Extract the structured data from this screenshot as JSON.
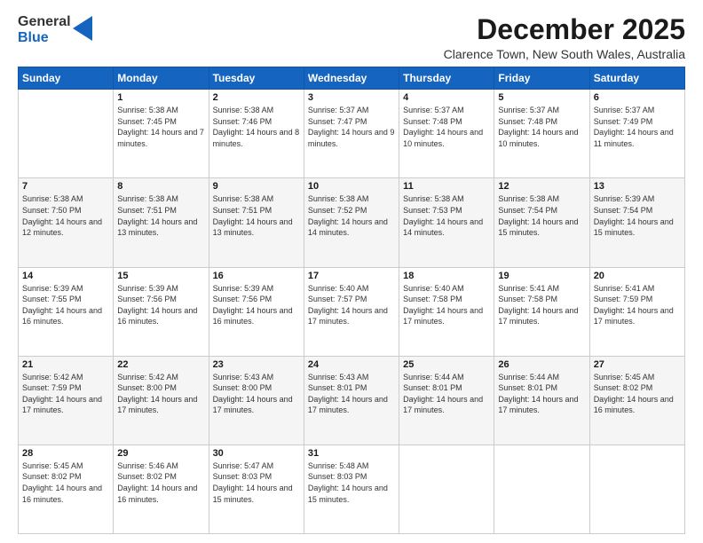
{
  "logo": {
    "general": "General",
    "blue": "Blue"
  },
  "header": {
    "month": "December 2025",
    "location": "Clarence Town, New South Wales, Australia"
  },
  "weekdays": [
    "Sunday",
    "Monday",
    "Tuesday",
    "Wednesday",
    "Thursday",
    "Friday",
    "Saturday"
  ],
  "weeks": [
    [
      {
        "day": "",
        "sunrise": "",
        "sunset": "",
        "daylight": ""
      },
      {
        "day": "1",
        "sunrise": "Sunrise: 5:38 AM",
        "sunset": "Sunset: 7:45 PM",
        "daylight": "Daylight: 14 hours and 7 minutes."
      },
      {
        "day": "2",
        "sunrise": "Sunrise: 5:38 AM",
        "sunset": "Sunset: 7:46 PM",
        "daylight": "Daylight: 14 hours and 8 minutes."
      },
      {
        "day": "3",
        "sunrise": "Sunrise: 5:37 AM",
        "sunset": "Sunset: 7:47 PM",
        "daylight": "Daylight: 14 hours and 9 minutes."
      },
      {
        "day": "4",
        "sunrise": "Sunrise: 5:37 AM",
        "sunset": "Sunset: 7:48 PM",
        "daylight": "Daylight: 14 hours and 10 minutes."
      },
      {
        "day": "5",
        "sunrise": "Sunrise: 5:37 AM",
        "sunset": "Sunset: 7:48 PM",
        "daylight": "Daylight: 14 hours and 10 minutes."
      },
      {
        "day": "6",
        "sunrise": "Sunrise: 5:37 AM",
        "sunset": "Sunset: 7:49 PM",
        "daylight": "Daylight: 14 hours and 11 minutes."
      }
    ],
    [
      {
        "day": "7",
        "sunrise": "Sunrise: 5:38 AM",
        "sunset": "Sunset: 7:50 PM",
        "daylight": "Daylight: 14 hours and 12 minutes."
      },
      {
        "day": "8",
        "sunrise": "Sunrise: 5:38 AM",
        "sunset": "Sunset: 7:51 PM",
        "daylight": "Daylight: 14 hours and 13 minutes."
      },
      {
        "day": "9",
        "sunrise": "Sunrise: 5:38 AM",
        "sunset": "Sunset: 7:51 PM",
        "daylight": "Daylight: 14 hours and 13 minutes."
      },
      {
        "day": "10",
        "sunrise": "Sunrise: 5:38 AM",
        "sunset": "Sunset: 7:52 PM",
        "daylight": "Daylight: 14 hours and 14 minutes."
      },
      {
        "day": "11",
        "sunrise": "Sunrise: 5:38 AM",
        "sunset": "Sunset: 7:53 PM",
        "daylight": "Daylight: 14 hours and 14 minutes."
      },
      {
        "day": "12",
        "sunrise": "Sunrise: 5:38 AM",
        "sunset": "Sunset: 7:54 PM",
        "daylight": "Daylight: 14 hours and 15 minutes."
      },
      {
        "day": "13",
        "sunrise": "Sunrise: 5:39 AM",
        "sunset": "Sunset: 7:54 PM",
        "daylight": "Daylight: 14 hours and 15 minutes."
      }
    ],
    [
      {
        "day": "14",
        "sunrise": "Sunrise: 5:39 AM",
        "sunset": "Sunset: 7:55 PM",
        "daylight": "Daylight: 14 hours and 16 minutes."
      },
      {
        "day": "15",
        "sunrise": "Sunrise: 5:39 AM",
        "sunset": "Sunset: 7:56 PM",
        "daylight": "Daylight: 14 hours and 16 minutes."
      },
      {
        "day": "16",
        "sunrise": "Sunrise: 5:39 AM",
        "sunset": "Sunset: 7:56 PM",
        "daylight": "Daylight: 14 hours and 16 minutes."
      },
      {
        "day": "17",
        "sunrise": "Sunrise: 5:40 AM",
        "sunset": "Sunset: 7:57 PM",
        "daylight": "Daylight: 14 hours and 17 minutes."
      },
      {
        "day": "18",
        "sunrise": "Sunrise: 5:40 AM",
        "sunset": "Sunset: 7:58 PM",
        "daylight": "Daylight: 14 hours and 17 minutes."
      },
      {
        "day": "19",
        "sunrise": "Sunrise: 5:41 AM",
        "sunset": "Sunset: 7:58 PM",
        "daylight": "Daylight: 14 hours and 17 minutes."
      },
      {
        "day": "20",
        "sunrise": "Sunrise: 5:41 AM",
        "sunset": "Sunset: 7:59 PM",
        "daylight": "Daylight: 14 hours and 17 minutes."
      }
    ],
    [
      {
        "day": "21",
        "sunrise": "Sunrise: 5:42 AM",
        "sunset": "Sunset: 7:59 PM",
        "daylight": "Daylight: 14 hours and 17 minutes."
      },
      {
        "day": "22",
        "sunrise": "Sunrise: 5:42 AM",
        "sunset": "Sunset: 8:00 PM",
        "daylight": "Daylight: 14 hours and 17 minutes."
      },
      {
        "day": "23",
        "sunrise": "Sunrise: 5:43 AM",
        "sunset": "Sunset: 8:00 PM",
        "daylight": "Daylight: 14 hours and 17 minutes."
      },
      {
        "day": "24",
        "sunrise": "Sunrise: 5:43 AM",
        "sunset": "Sunset: 8:01 PM",
        "daylight": "Daylight: 14 hours and 17 minutes."
      },
      {
        "day": "25",
        "sunrise": "Sunrise: 5:44 AM",
        "sunset": "Sunset: 8:01 PM",
        "daylight": "Daylight: 14 hours and 17 minutes."
      },
      {
        "day": "26",
        "sunrise": "Sunrise: 5:44 AM",
        "sunset": "Sunset: 8:01 PM",
        "daylight": "Daylight: 14 hours and 17 minutes."
      },
      {
        "day": "27",
        "sunrise": "Sunrise: 5:45 AM",
        "sunset": "Sunset: 8:02 PM",
        "daylight": "Daylight: 14 hours and 16 minutes."
      }
    ],
    [
      {
        "day": "28",
        "sunrise": "Sunrise: 5:45 AM",
        "sunset": "Sunset: 8:02 PM",
        "daylight": "Daylight: 14 hours and 16 minutes."
      },
      {
        "day": "29",
        "sunrise": "Sunrise: 5:46 AM",
        "sunset": "Sunset: 8:02 PM",
        "daylight": "Daylight: 14 hours and 16 minutes."
      },
      {
        "day": "30",
        "sunrise": "Sunrise: 5:47 AM",
        "sunset": "Sunset: 8:03 PM",
        "daylight": "Daylight: 14 hours and 15 minutes."
      },
      {
        "day": "31",
        "sunrise": "Sunrise: 5:48 AM",
        "sunset": "Sunset: 8:03 PM",
        "daylight": "Daylight: 14 hours and 15 minutes."
      },
      {
        "day": "",
        "sunrise": "",
        "sunset": "",
        "daylight": ""
      },
      {
        "day": "",
        "sunrise": "",
        "sunset": "",
        "daylight": ""
      },
      {
        "day": "",
        "sunrise": "",
        "sunset": "",
        "daylight": ""
      }
    ]
  ]
}
